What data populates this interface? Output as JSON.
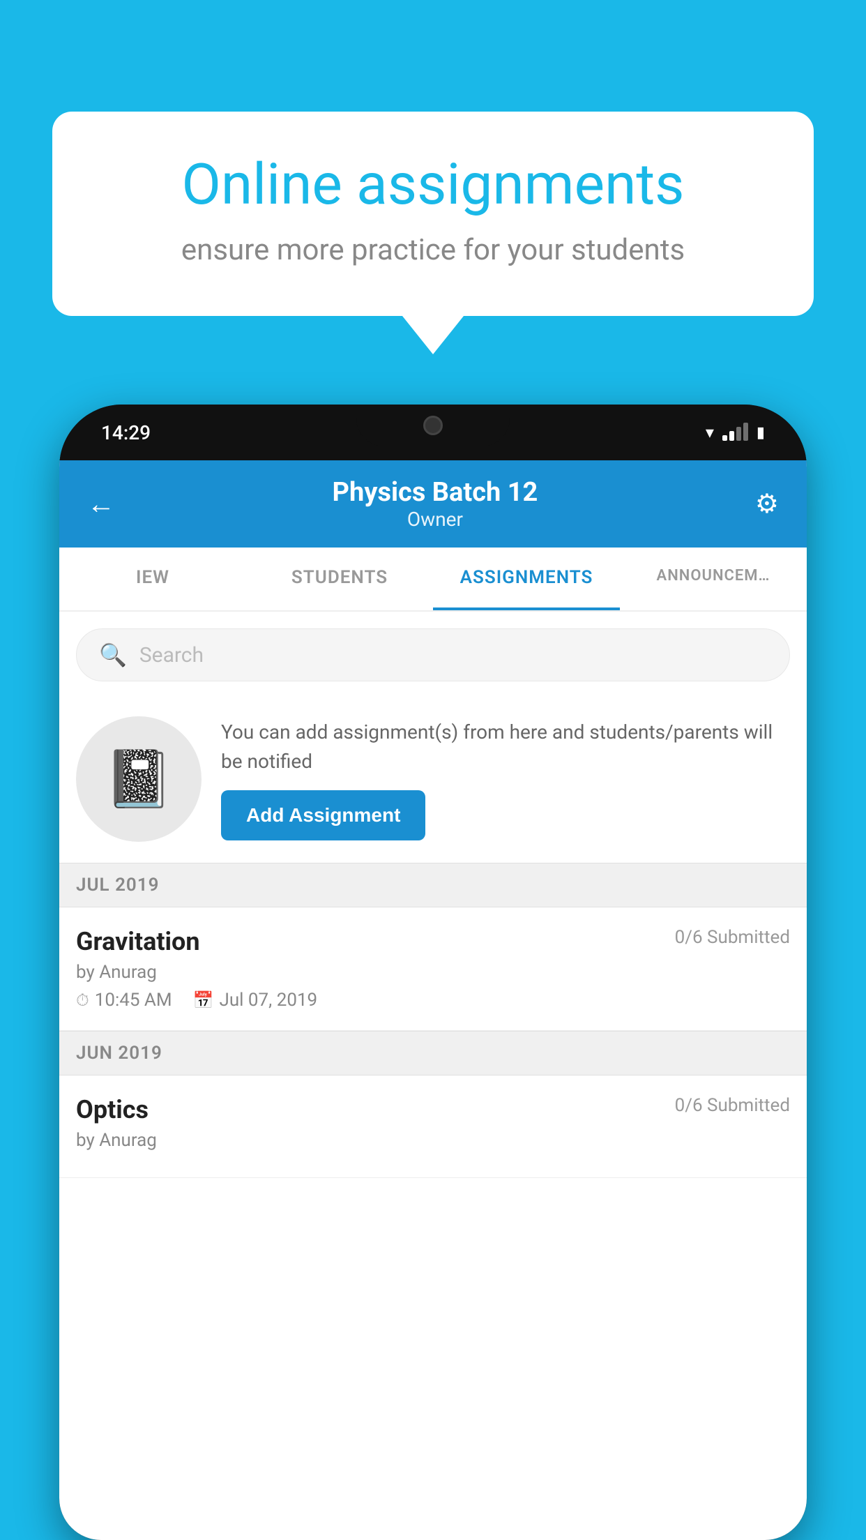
{
  "background_color": "#1ab8e8",
  "speech_bubble": {
    "title": "Online assignments",
    "subtitle": "ensure more practice for your students"
  },
  "phone": {
    "status_bar": {
      "time": "14:29"
    },
    "header": {
      "title": "Physics Batch 12",
      "subtitle": "Owner"
    },
    "tabs": [
      {
        "label": "IEW",
        "active": false
      },
      {
        "label": "STUDENTS",
        "active": false
      },
      {
        "label": "ASSIGNMENTS",
        "active": true
      },
      {
        "label": "ANNOUNCEM…",
        "active": false
      }
    ],
    "search": {
      "placeholder": "Search"
    },
    "promo": {
      "description": "You can add assignment(s) from here and students/parents will be notified",
      "button_label": "Add Assignment"
    },
    "sections": [
      {
        "title": "JUL 2019",
        "assignments": [
          {
            "title": "Gravitation",
            "status": "0/6 Submitted",
            "author": "by Anurag",
            "time": "10:45 AM",
            "date": "Jul 07, 2019"
          }
        ]
      },
      {
        "title": "JUN 2019",
        "assignments": [
          {
            "title": "Optics",
            "status": "0/6 Submitted",
            "author": "by Anurag",
            "time": "",
            "date": ""
          }
        ]
      }
    ]
  }
}
